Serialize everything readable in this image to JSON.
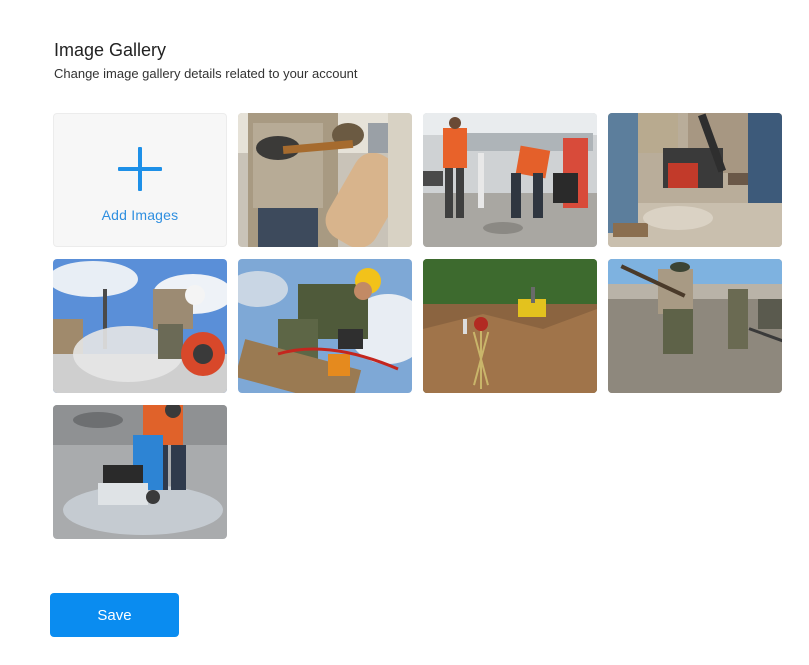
{
  "header": {
    "title": "Image Gallery",
    "subtitle": "Change image gallery details related to your account"
  },
  "gallery": {
    "add_label": "Add Images",
    "photos": [
      {
        "subject": "worker hands with power tool"
      },
      {
        "subject": "road workers in orange vests"
      },
      {
        "subject": "plate compactor on dirt"
      },
      {
        "subject": "concrete saw cutting with dust"
      },
      {
        "subject": "worker in yellow hard hat"
      },
      {
        "subject": "survey level at excavation site"
      },
      {
        "subject": "workers spreading concrete"
      },
      {
        "subject": "floor saw cutting wet pavement"
      }
    ]
  },
  "actions": {
    "save_label": "Save"
  },
  "colors": {
    "accent": "#0a8cf0",
    "plus": "#1e90e8"
  }
}
